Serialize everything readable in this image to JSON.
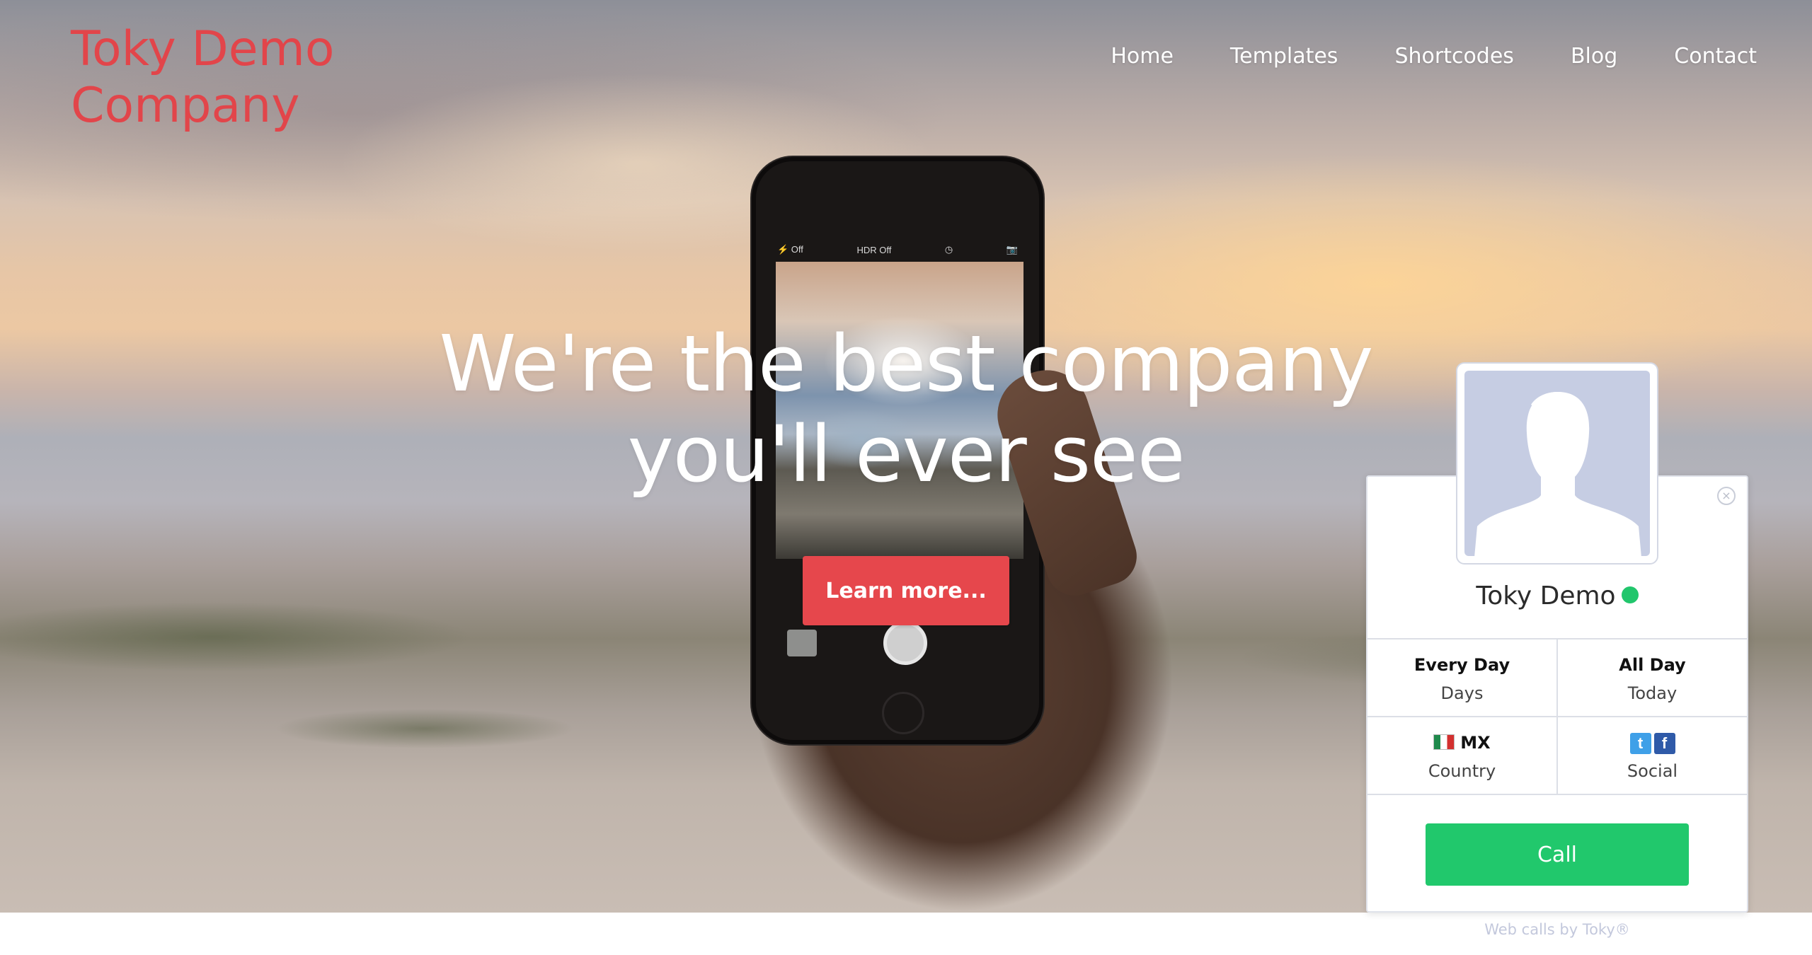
{
  "header": {
    "logo": "Toky Demo Company",
    "nav": [
      "Home",
      "Templates",
      "Shortcodes",
      "Blog",
      "Contact"
    ]
  },
  "hero": {
    "title": "We're the best company you'll ever see",
    "button_label": "Learn more...",
    "phone_status": [
      "⚡ Off",
      "HDR Off",
      "◷",
      "📷"
    ]
  },
  "widget": {
    "agent_name": "Toky Demo",
    "status_color": "#21c66c",
    "close_icon": "×",
    "cells": [
      {
        "value": "Every Day",
        "label": "Days"
      },
      {
        "value": "All Day",
        "label": "Today"
      },
      {
        "value": "MX",
        "label": "Country"
      },
      {
        "value": "",
        "label": "Social"
      }
    ],
    "social": [
      "t",
      "f"
    ],
    "call_label": "Call",
    "powered_by": "Web calls by Toky®"
  },
  "colors": {
    "brand_red": "#e2454a",
    "button_red": "#e6474c",
    "call_green": "#21c86c"
  }
}
